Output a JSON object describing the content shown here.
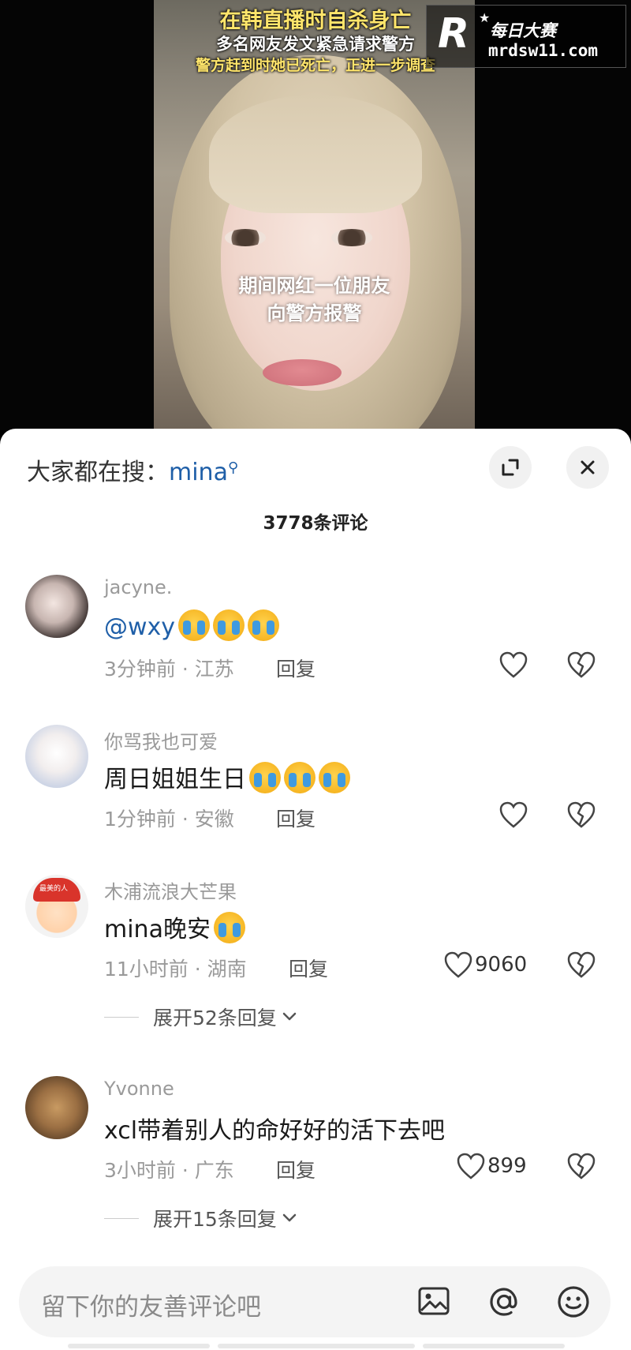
{
  "video": {
    "caption_line1": "在韩直播时自杀身亡",
    "caption_line2": "多名网友发文紧急请求警方",
    "caption_line3": "警方赶到时她已死亡，正进一步调查",
    "subtitle_line1": "期间网红一位朋友",
    "subtitle_line2": "向警方报警",
    "watermark_logo": "R",
    "watermark_cn": "每日大赛",
    "watermark_url": "mrdsw11.com"
  },
  "search": {
    "prefix": "大家都在搜：",
    "keyword": "mina"
  },
  "comment_count": "3778条评论",
  "comments": [
    {
      "username": "jacyne.",
      "text": "@wxy",
      "emoji_count": 3,
      "time": "3分钟前 · 江苏",
      "reply": "回复",
      "likes": "",
      "expand": ""
    },
    {
      "username": "你骂我也可爱",
      "text": "周日姐姐生日",
      "emoji_count": 3,
      "time": "1分钟前 · 安徽",
      "reply": "回复",
      "likes": "",
      "expand": ""
    },
    {
      "username": "木浦流浪大芒果",
      "text": "mina晚安",
      "emoji_count": 1,
      "time": "11小时前 · 湖南",
      "reply": "回复",
      "likes": "9060",
      "expand": "展开52条回复",
      "avatar_text": "最美的人"
    },
    {
      "username": "Yvonne",
      "text": "xcl带着别人的命好好的活下去吧",
      "emoji_count": 0,
      "time": "3小时前 · 广东",
      "reply": "回复",
      "likes": "899",
      "expand": "展开15条回复"
    }
  ],
  "input": {
    "placeholder": "留下你的友善评论吧"
  },
  "icons": {
    "expand": "expand-icon",
    "close": "close-icon",
    "heart": "heart-icon",
    "broken_heart": "broken-heart-icon",
    "image": "image-icon",
    "at": "at-icon",
    "emoji": "emoji-icon"
  }
}
